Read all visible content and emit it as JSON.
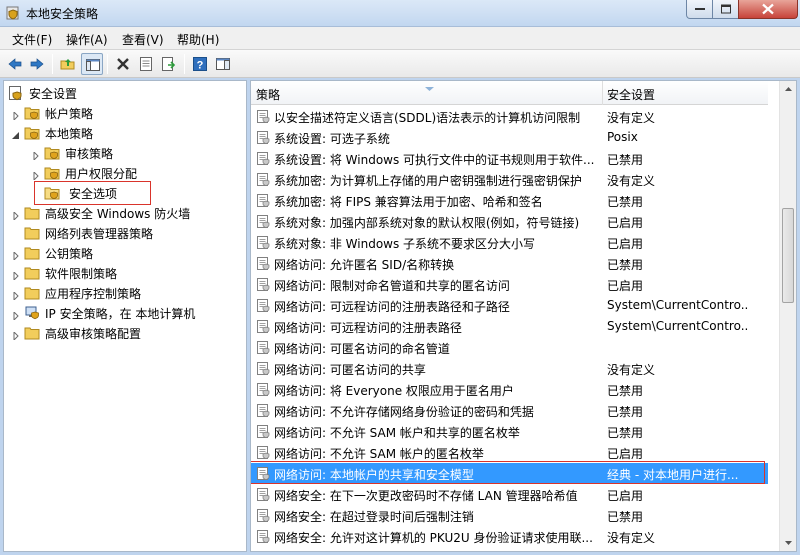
{
  "window": {
    "title": "本地安全策略"
  },
  "menu": {
    "items": [
      "文件(F)",
      "操作(A)",
      "查看(V)",
      "帮助(H)"
    ]
  },
  "tree": {
    "items": [
      {
        "label": "安全设置",
        "icon": "security-settings-icon"
      },
      {
        "label": "帐户策略",
        "icon": "folder-lock-icon"
      },
      {
        "label": "本地策略",
        "icon": "folder-lock-icon"
      },
      {
        "label": "审核策略",
        "icon": "folder-lock-icon"
      },
      {
        "label": "用户权限分配",
        "icon": "folder-lock-icon"
      },
      {
        "label": "安全选项",
        "icon": "folder-lock-icon"
      },
      {
        "label": "高级安全 Windows 防火墙",
        "icon": "folder-icon"
      },
      {
        "label": "网络列表管理器策略",
        "icon": "folder-icon"
      },
      {
        "label": "公钥策略",
        "icon": "folder-icon"
      },
      {
        "label": "软件限制策略",
        "icon": "folder-icon"
      },
      {
        "label": "应用程序控制策略",
        "icon": "folder-icon"
      },
      {
        "label": "IP 安全策略，在 本地计算机",
        "icon": "ip-security-icon"
      },
      {
        "label": "高级审核策略配置",
        "icon": "folder-icon"
      }
    ],
    "selected": "安全选项"
  },
  "list": {
    "columns": {
      "policy": "策略",
      "setting": "安全设置"
    },
    "rows": [
      {
        "policy": "以安全描述符定义语言(SDDL)语法表示的计算机访问限制",
        "setting": "没有定义"
      },
      {
        "policy": "系统设置: 可选子系统",
        "setting": "Posix"
      },
      {
        "policy": "系统设置: 将 Windows 可执行文件中的证书规则用于软件...",
        "setting": "已禁用"
      },
      {
        "policy": "系统加密: 为计算机上存储的用户密钥强制进行强密钥保护",
        "setting": "没有定义"
      },
      {
        "policy": "系统加密: 将 FIPS 兼容算法用于加密、哈希和签名",
        "setting": "已禁用"
      },
      {
        "policy": "系统对象: 加强内部系统对象的默认权限(例如，符号链接)",
        "setting": "已启用"
      },
      {
        "policy": "系统对象: 非 Windows 子系统不要求区分大小写",
        "setting": "已启用"
      },
      {
        "policy": "网络访问: 允许匿名 SID/名称转换",
        "setting": "已禁用"
      },
      {
        "policy": "网络访问: 限制对命名管道和共享的匿名访问",
        "setting": "已启用"
      },
      {
        "policy": "网络访问: 可远程访问的注册表路径和子路径",
        "setting": "System\\CurrentContro..."
      },
      {
        "policy": "网络访问: 可远程访问的注册表路径",
        "setting": "System\\CurrentContro..."
      },
      {
        "policy": "网络访问: 可匿名访问的命名管道",
        "setting": ""
      },
      {
        "policy": "网络访问: 可匿名访问的共享",
        "setting": "没有定义"
      },
      {
        "policy": "网络访问: 将 Everyone 权限应用于匿名用户",
        "setting": "已禁用"
      },
      {
        "policy": "网络访问: 不允许存储网络身份验证的密码和凭据",
        "setting": "已禁用"
      },
      {
        "policy": "网络访问: 不允许 SAM 帐户和共享的匿名枚举",
        "setting": "已禁用"
      },
      {
        "policy": "网络访问: 不允许 SAM 帐户的匿名枚举",
        "setting": "已启用"
      },
      {
        "policy": "网络访问: 本地帐户的共享和安全模型",
        "setting": "经典 - 对本地用户进行..."
      },
      {
        "policy": "网络安全: 在下一次更改密码时不存储 LAN 管理器哈希值",
        "setting": "已启用"
      },
      {
        "policy": "网络安全: 在超过登录时间后强制注销",
        "setting": "已禁用"
      },
      {
        "policy": "网络安全: 允许对这计算机的 PKU2U 身份验证请求使用联...",
        "setting": "没有定义"
      }
    ],
    "selected_index": 17
  },
  "colors": {
    "selection": "#3399ff",
    "annotation_box": "#d9342b"
  }
}
